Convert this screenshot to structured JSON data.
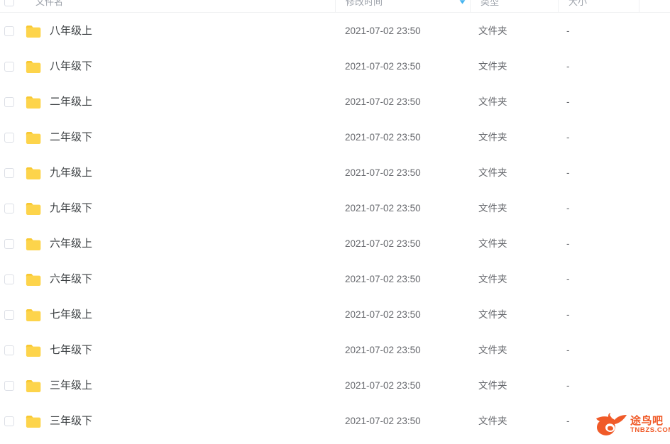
{
  "header": {
    "select_all_checkbox": "select-all",
    "columns": [
      {
        "key": "name",
        "label": "文件名"
      },
      {
        "key": "time",
        "label": "修改时间"
      },
      {
        "key": "type",
        "label": "类型"
      },
      {
        "key": "size",
        "label": "大小"
      }
    ],
    "sort": {
      "column": "修改时间",
      "direction": "descending",
      "icon": "sort-descending-arrow-icon",
      "color": "#45b4f0"
    }
  },
  "icons": {
    "folder": "folder-icon",
    "folder_color": "#fdd44b",
    "folder_color_dark": "#f8c832",
    "checkbox": "checkbox-unchecked-icon"
  },
  "rows": [
    {
      "name": "八年级上",
      "time": "2021-07-02 23:50",
      "type": "文件夹",
      "size": "-"
    },
    {
      "name": "八年级下",
      "time": "2021-07-02 23:50",
      "type": "文件夹",
      "size": "-"
    },
    {
      "name": "二年级上",
      "time": "2021-07-02 23:50",
      "type": "文件夹",
      "size": "-"
    },
    {
      "name": "二年级下",
      "time": "2021-07-02 23:50",
      "type": "文件夹",
      "size": "-"
    },
    {
      "name": "九年级上",
      "time": "2021-07-02 23:50",
      "type": "文件夹",
      "size": "-"
    },
    {
      "name": "九年级下",
      "time": "2021-07-02 23:50",
      "type": "文件夹",
      "size": "-"
    },
    {
      "name": "六年级上",
      "time": "2021-07-02 23:50",
      "type": "文件夹",
      "size": "-"
    },
    {
      "name": "六年级下",
      "time": "2021-07-02 23:50",
      "type": "文件夹",
      "size": "-"
    },
    {
      "name": "七年级上",
      "time": "2021-07-02 23:50",
      "type": "文件夹",
      "size": "-"
    },
    {
      "name": "七年级下",
      "time": "2021-07-02 23:50",
      "type": "文件夹",
      "size": "-"
    },
    {
      "name": "三年级上",
      "time": "2021-07-02 23:50",
      "type": "文件夹",
      "size": "-"
    },
    {
      "name": "三年级下",
      "time": "2021-07-02 23:50",
      "type": "文件夹",
      "size": "-"
    }
  ],
  "watermark": {
    "brand": "途鸟吧",
    "domain": "TNBZS.COM",
    "logo": "phoenix-bird-logo-icon",
    "color": "#f05a28"
  }
}
